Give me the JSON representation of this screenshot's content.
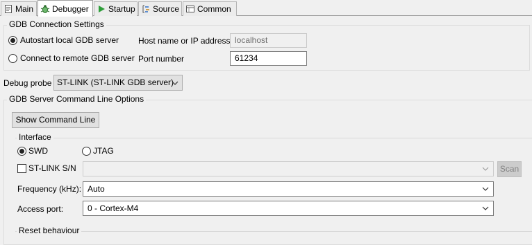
{
  "tabs": [
    {
      "label": "Main",
      "icon": "main-tab-icon",
      "active": false
    },
    {
      "label": "Debugger",
      "icon": "debugger-bug-icon",
      "active": true
    },
    {
      "label": "Startup",
      "icon": "startup-play-icon",
      "active": false
    },
    {
      "label": "Source",
      "icon": "source-icon",
      "active": false
    },
    {
      "label": "Common",
      "icon": "common-icon",
      "active": false
    }
  ],
  "gdb_connection": {
    "title": "GDB Connection Settings",
    "autostart_label": "Autostart local GDB server",
    "autostart_selected": true,
    "remote_label": "Connect to remote GDB server",
    "remote_selected": false,
    "host_label": "Host name or IP address",
    "host_value": "localhost",
    "port_label": "Port number",
    "port_value": "61234"
  },
  "debug_probe": {
    "label": "Debug probe",
    "value": "ST-LINK (ST-LINK GDB server)"
  },
  "gdb_server_options": {
    "title": "GDB Server Command Line Options",
    "show_cmd_button": "Show Command Line",
    "interface": {
      "title": "Interface",
      "swd_label": "SWD",
      "swd_selected": true,
      "jtag_label": "JTAG",
      "jtag_selected": false,
      "stlink_sn_label": "ST-LINK S/N",
      "stlink_sn_checked": false,
      "stlink_sn_value": "",
      "scan_button": "Scan",
      "frequency_label": "Frequency (kHz):",
      "frequency_value": "Auto",
      "access_port_label": "Access port:",
      "access_port_value": "0 - Cortex-M4"
    },
    "reset_behaviour_title": "Reset behaviour"
  },
  "colors": {
    "window_bg": "#f0f0f0",
    "active_tab_bg": "#ffffff",
    "debugger_icon": "#3a8a3a",
    "startup_icon": "#2e9e3a"
  }
}
